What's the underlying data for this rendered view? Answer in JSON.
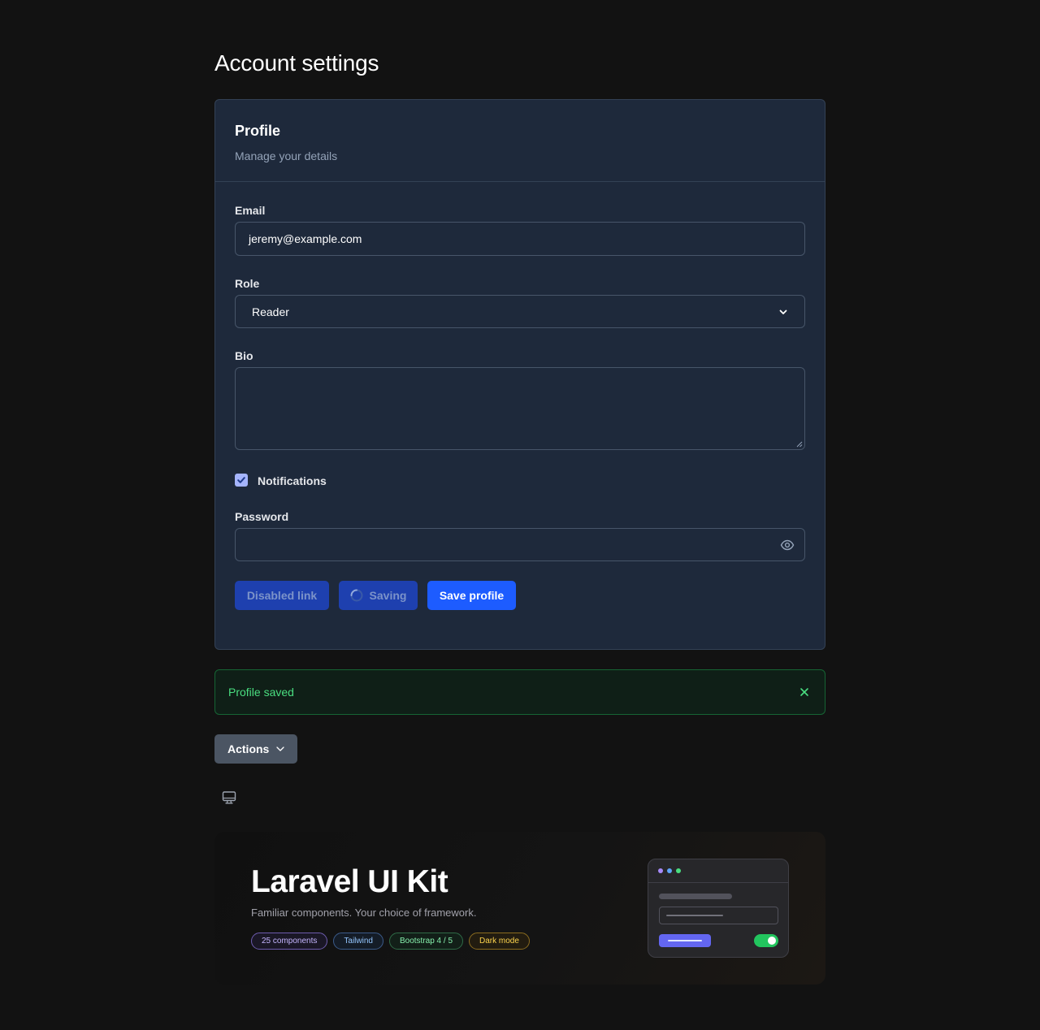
{
  "page": {
    "title": "Account settings"
  },
  "profile": {
    "title": "Profile",
    "subtitle": "Manage your details",
    "email": {
      "label": "Email",
      "value": "jeremy@example.com"
    },
    "role": {
      "label": "Role",
      "selected": "Reader"
    },
    "bio": {
      "label": "Bio",
      "value": ""
    },
    "notifications": {
      "label": "Notifications",
      "checked": true
    },
    "password": {
      "label": "Password",
      "value": ""
    },
    "buttons": {
      "disabled_link": "Disabled link",
      "saving": "Saving",
      "save": "Save profile"
    }
  },
  "alert": {
    "text": "Profile saved"
  },
  "actions": {
    "label": "Actions"
  },
  "hero": {
    "title": "Laravel UI Kit",
    "subtitle": "Familiar components. Your choice of framework.",
    "tags": [
      "25 components",
      "Tailwind",
      "Bootstrap 4 / 5",
      "Dark mode"
    ]
  },
  "colors": {
    "primary": "#1d5cff",
    "success": "#4ade80",
    "card_bg": "#1e293b"
  }
}
